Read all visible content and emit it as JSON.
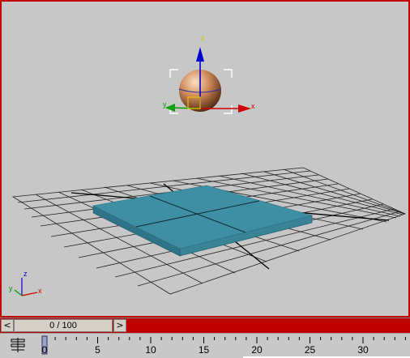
{
  "viewport": {
    "gizmo_axes": {
      "x": "x",
      "y": "y",
      "z": "z"
    },
    "corner_axes": {
      "x": "x",
      "y": "y",
      "z": "z"
    },
    "colors": {
      "border": "#c00000",
      "background": "#c7c7c7",
      "grid": "#1a1a1a",
      "box_top": "#3f8fa4",
      "box_side": "#2e7486",
      "sphere": "#d08a5a",
      "axis_x": "#d00000",
      "axis_y": "#00a000",
      "axis_z": "#0000d0",
      "gizmo_handle": "#e8c000"
    }
  },
  "time_slider": {
    "frame_display": "0 / 100",
    "prev_label": "<",
    "next_label": ">"
  },
  "track_bar": {
    "ticks": [
      "0",
      "5",
      "10",
      "15",
      "20",
      "25",
      "30"
    ]
  }
}
